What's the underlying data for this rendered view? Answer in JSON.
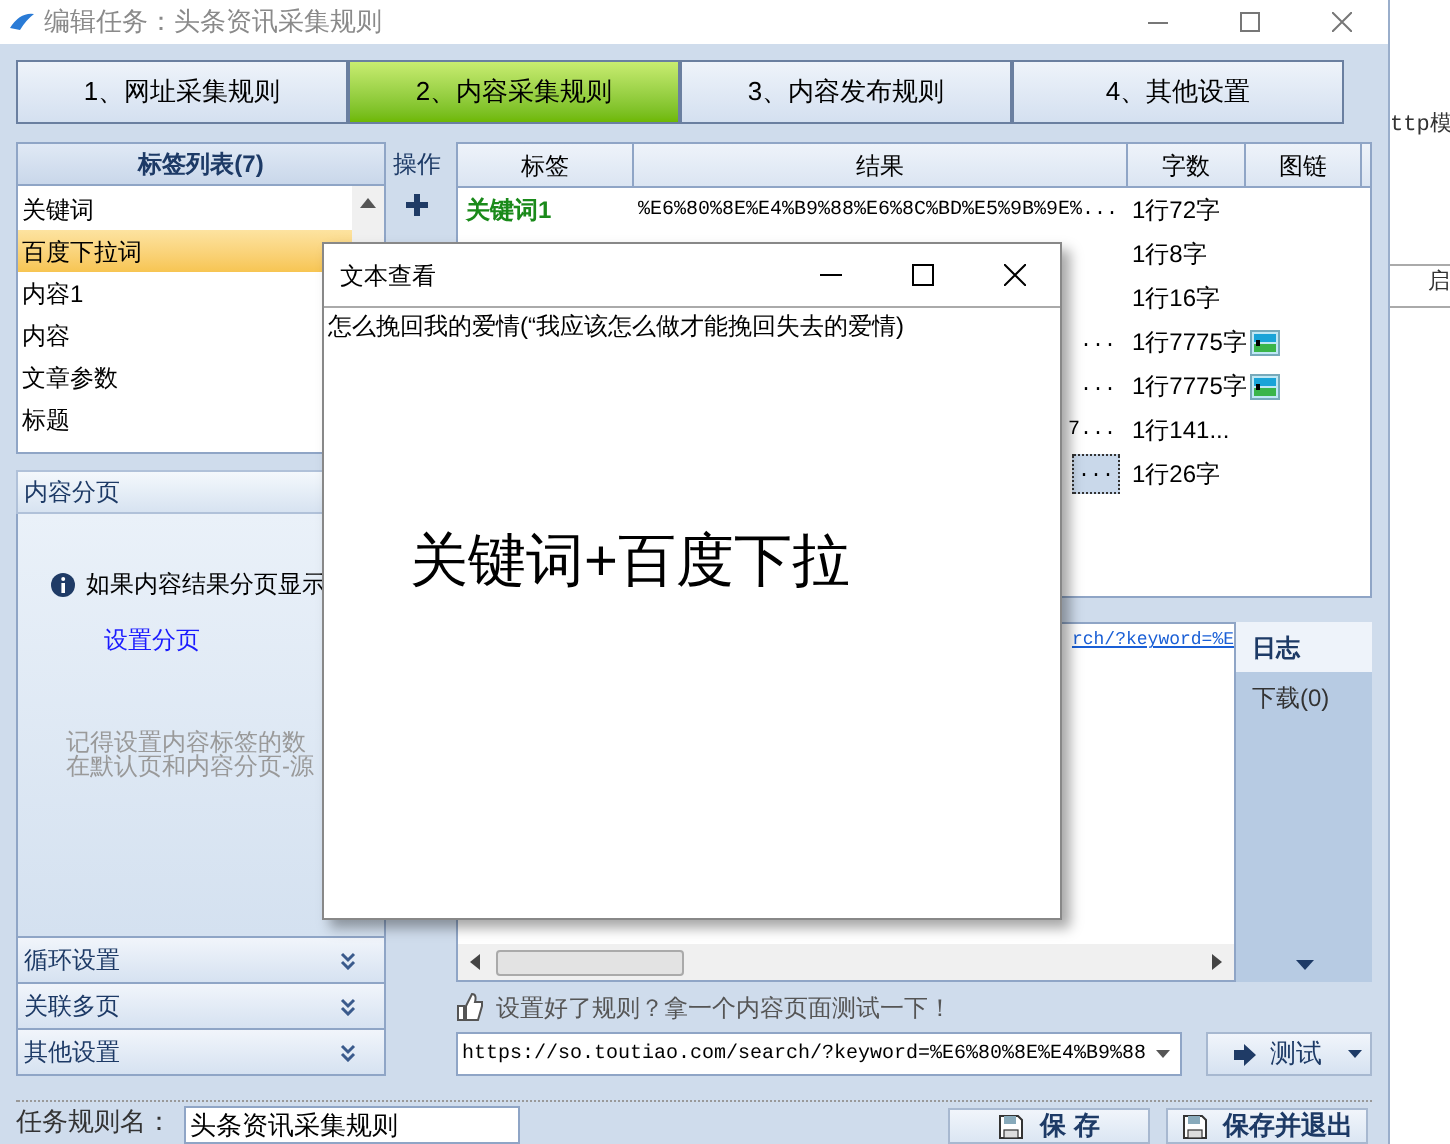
{
  "window": {
    "title": "编辑任务：头条资讯采集规则"
  },
  "steps": [
    {
      "label": "1、网址采集规则",
      "selected": false
    },
    {
      "label": "2、内容采集规则",
      "selected": true
    },
    {
      "label": "3、内容发布规则",
      "selected": false
    },
    {
      "label": "4、其他设置",
      "selected": false
    }
  ],
  "tag_list": {
    "title": "标签列表(7)",
    "items": [
      {
        "label": "关键词",
        "selected": false
      },
      {
        "label": "百度下拉词",
        "selected": true
      },
      {
        "label": "内容1",
        "selected": false
      },
      {
        "label": "内容",
        "selected": false
      },
      {
        "label": "文章参数",
        "selected": false
      },
      {
        "label": "标题",
        "selected": false
      }
    ]
  },
  "operations": {
    "title": "操作"
  },
  "pagination": {
    "title": "内容分页",
    "info": "如果内容结果分页显示",
    "link": "设置分页",
    "note_lines": [
      "记得设置内容标签的数",
      "在默认页和内容分页-源"
    ]
  },
  "sections": [
    {
      "label": "循环设置"
    },
    {
      "label": "关联多页"
    },
    {
      "label": "其他设置"
    }
  ],
  "results_table": {
    "columns": [
      "标签",
      "结果",
      "字数",
      "图链"
    ],
    "rows": [
      {
        "label": "关键词1",
        "result": "%E6%80%8E%E4%B9%88%E6%8C%BD%E5%9B%9E%...",
        "count": "1行72字",
        "has_image": false,
        "selected": false
      },
      {
        "count": "1行8字",
        "has_image": false,
        "selected": false
      },
      {
        "count": "1行16字",
        "has_image": false,
        "selected": false
      },
      {
        "result": "...",
        "count": "1行7775字",
        "has_image": true,
        "selected": false
      },
      {
        "result": "...",
        "count": "1行7775字",
        "has_image": true,
        "selected": false
      },
      {
        "result": "7...",
        "count": "1行141...",
        "has_image": false,
        "selected": false
      },
      {
        "result": "...",
        "count": "1行26字",
        "has_image": false,
        "selected": true
      }
    ]
  },
  "log": {
    "link": "rch/?keyword=%E",
    "tabs": [
      {
        "label": "日志",
        "selected": true
      },
      {
        "label": "下载(0)",
        "selected": false
      }
    ]
  },
  "test_hint": "设置好了规则？拿一个内容页面测试一下！",
  "test_url": "https://so.toutiao.com/search/?keyword=%E6%80%8E%E4%B9%88",
  "test_button": "测试",
  "rule_name": {
    "label": "任务规则名：",
    "value": "头条资讯采集规则"
  },
  "buttons": [
    "保 存",
    "保存并退出"
  ],
  "dialog": {
    "title": "文本查看",
    "text": "怎么挽回我的爱情(“我应该怎么做才能挽回失去的爱情)",
    "content": "关键词+百度下拉"
  },
  "background_app": {
    "fragments": [
      "ttp模",
      "启"
    ]
  }
}
